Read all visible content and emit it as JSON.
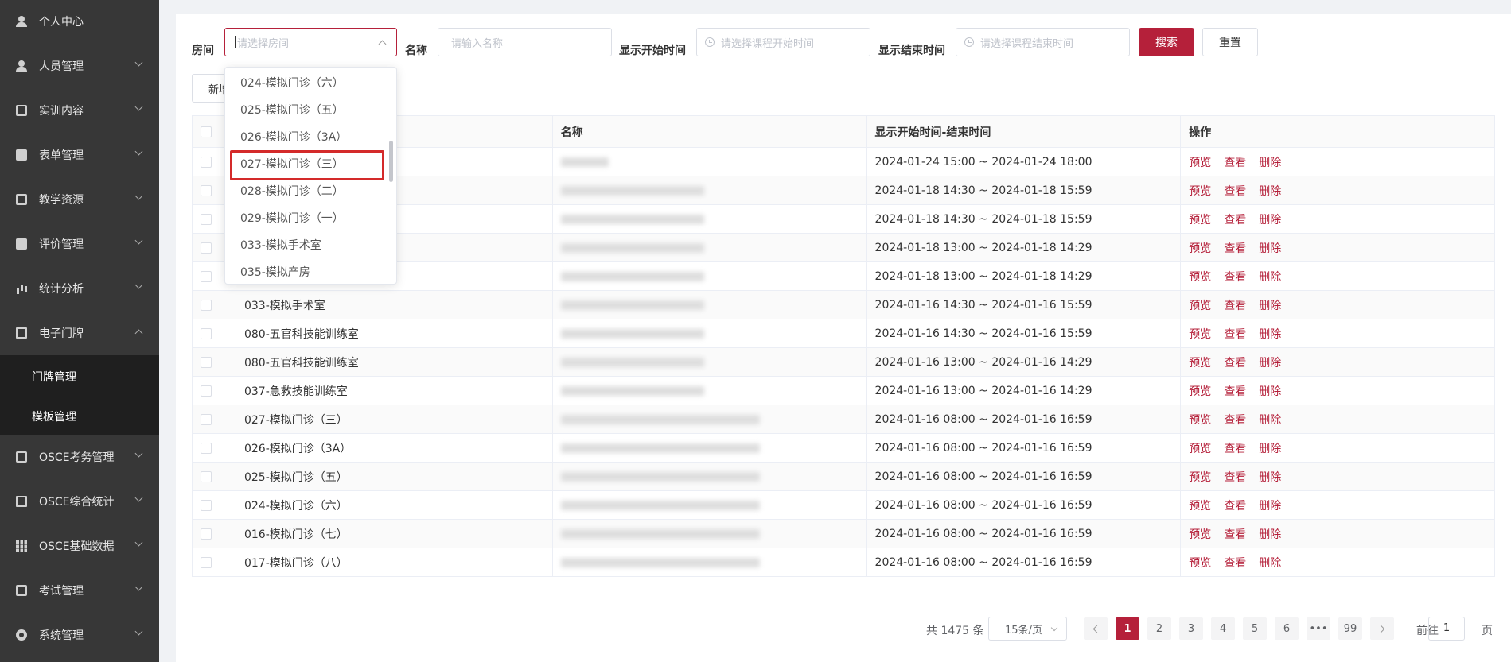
{
  "sidebar": {
    "items": [
      {
        "label": "个人中心",
        "icon": "user-icon"
      },
      {
        "label": "人员管理",
        "icon": "users-icon"
      },
      {
        "label": "实训内容",
        "icon": "content-icon"
      },
      {
        "label": "表单管理",
        "icon": "form-icon"
      },
      {
        "label": "教学资源",
        "icon": "book-icon"
      },
      {
        "label": "评价管理",
        "icon": "evaluation-icon"
      },
      {
        "label": "统计分析",
        "icon": "bar-chart-icon"
      },
      {
        "label": "电子门牌",
        "icon": "monitor-icon"
      },
      {
        "label": "OSCE考务管理",
        "icon": "edit-icon"
      },
      {
        "label": "OSCE综合统计",
        "icon": "screen-chart-icon"
      },
      {
        "label": "OSCE基础数据",
        "icon": "grid-icon"
      },
      {
        "label": "考试管理",
        "icon": "book-open-icon"
      },
      {
        "label": "系统管理",
        "icon": "gear-icon"
      }
    ],
    "submenu": [
      "门牌管理",
      "模板管理"
    ]
  },
  "filters": {
    "room_label": "房间",
    "room_placeholder": "请选择房间",
    "name_label": "名称",
    "name_placeholder": "请输入名称",
    "start_label": "显示开始时间",
    "start_placeholder": "请选择课程开始时间",
    "end_label": "显示结束时间",
    "end_placeholder": "请选择课程结束时间",
    "search_button": "搜索",
    "reset_button": "重置"
  },
  "add_button": "新增",
  "dropdown": {
    "options": [
      "024-模拟门诊（六）",
      "025-模拟门诊（五）",
      "026-模拟门诊（3A）",
      "027-模拟门诊（三）",
      "028-模拟门诊（二）",
      "029-模拟门诊（一）",
      "033-模拟手术室",
      "035-模拟产房"
    ],
    "highlighted": "027-模拟门诊（三）"
  },
  "table": {
    "columns": [
      "",
      "",
      "名称",
      "显示开始时间-结束时间",
      "操作"
    ],
    "actions": [
      "预览",
      "查看",
      "删除"
    ],
    "rows": [
      {
        "room": "",
        "time": "2024-01-24 15:00 ~ 2024-01-24 18:00"
      },
      {
        "room": "",
        "time": "2024-01-18 14:30 ~ 2024-01-18 15:59"
      },
      {
        "room": "",
        "time": "2024-01-18 14:30 ~ 2024-01-18 15:59"
      },
      {
        "room": "",
        "time": "2024-01-18 13:00 ~ 2024-01-18 14:29"
      },
      {
        "room": "",
        "time": "2024-01-18 13:00 ~ 2024-01-18 14:29"
      },
      {
        "room": "033-模拟手术室",
        "time": "2024-01-16 14:30 ~ 2024-01-16 15:59"
      },
      {
        "room": "080-五官科技能训练室",
        "time": "2024-01-16 14:30 ~ 2024-01-16 15:59"
      },
      {
        "room": "080-五官科技能训练室",
        "time": "2024-01-16 13:00 ~ 2024-01-16 14:29"
      },
      {
        "room": "037-急救技能训练室",
        "time": "2024-01-16 13:00 ~ 2024-01-16 14:29"
      },
      {
        "room": "027-模拟门诊（三）",
        "time": "2024-01-16 08:00 ~ 2024-01-16 16:59"
      },
      {
        "room": "026-模拟门诊（3A）",
        "time": "2024-01-16 08:00 ~ 2024-01-16 16:59"
      },
      {
        "room": "025-模拟门诊（五）",
        "time": "2024-01-16 08:00 ~ 2024-01-16 16:59"
      },
      {
        "room": "024-模拟门诊（六）",
        "time": "2024-01-16 08:00 ~ 2024-01-16 16:59"
      },
      {
        "room": "016-模拟门诊（七）",
        "time": "2024-01-16 08:00 ~ 2024-01-16 16:59"
      },
      {
        "room": "017-模拟门诊（八）",
        "time": "2024-01-16 08:00 ~ 2024-01-16 16:59"
      }
    ]
  },
  "pagination": {
    "total_text": "共 1475 条",
    "page_size": "15条/页",
    "pages": [
      "1",
      "2",
      "3",
      "4",
      "5",
      "6",
      "•••",
      "99"
    ],
    "current": "1",
    "goto_label": "前往",
    "goto_value": "1",
    "page_suffix": "页"
  },
  "colors": {
    "primary": "#b5203a",
    "sidebar": "#373737",
    "highlight_box": "#d42a2a"
  }
}
